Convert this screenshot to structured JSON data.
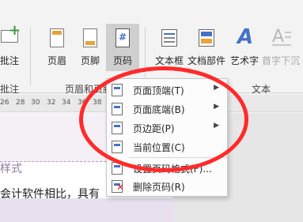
{
  "ribbon": {
    "buttons": {
      "comment": "批注",
      "header": "页眉",
      "footer": "页脚",
      "page_number": "页码",
      "text_box": "文本框",
      "quick_parts": "文档部件",
      "wordart": "艺术字",
      "drop_cap": "首字下沉"
    },
    "groups": {
      "comments": "批注",
      "header_footer": "页眉和页脚",
      "text": "文本"
    }
  },
  "ruler": {
    "ticks": [
      "26",
      "28",
      "30",
      "32",
      "34",
      "36",
      "38"
    ]
  },
  "document": {
    "style_text": "样式",
    "body_text": "会计软件相比，具有"
  },
  "page_number_menu": {
    "items": [
      {
        "label": "页面顶端(T)",
        "has_submenu": true
      },
      {
        "label": "页面底端(B)",
        "has_submenu": true
      },
      {
        "label": "页边距(P)",
        "has_submenu": true
      },
      {
        "label": "当前位置(C)",
        "has_submenu": false
      },
      {
        "label": "设置页码格式(F)...",
        "has_submenu": false
      },
      {
        "label": "删除页码(R)",
        "has_submenu": false
      }
    ]
  },
  "colors": {
    "annotation": "#ff2a2a",
    "accent": "#4472c4",
    "icon_orange": "#e8a23a"
  },
  "icons": {
    "comment": "add-comment-icon",
    "header": "header-icon",
    "footer": "footer-icon",
    "page_number": "page-number-icon",
    "text_box": "text-box-icon",
    "quick_parts": "quick-parts-icon",
    "wordart": "wordart-icon",
    "drop_cap": "drop-cap-icon"
  }
}
